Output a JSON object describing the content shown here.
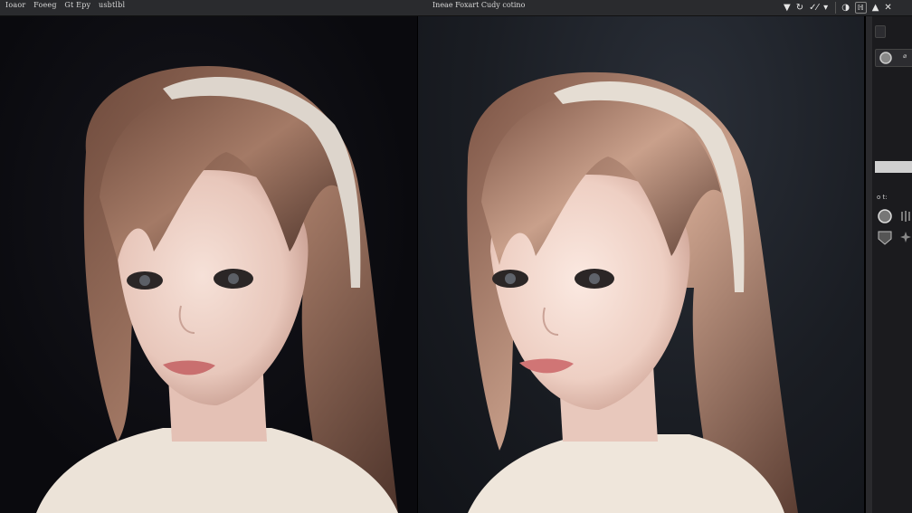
{
  "menu": [
    "Ioaor",
    "Foeeg",
    "Gt Epy",
    "usbtlbl"
  ],
  "window_title": "Ineae Foxart Cudy cotino",
  "toolbar_icons": [
    "filter-icon",
    "rotate-icon",
    "adjust-icon",
    "chevron-down-icon",
    "contrast-icon",
    "histogram-icon",
    "triangle-icon",
    "close-icon"
  ],
  "toolbar_glyphs": [
    "▼",
    "↻",
    "✓⁄",
    "▾",
    "◑",
    "ℍ",
    "▲",
    "✕"
  ],
  "panel": {
    "section_label": "o  t:",
    "side_glyph": "⌀"
  },
  "colors": {
    "topbar": "#2a2b2e",
    "panel": "#1b1b1e",
    "left_canvas": "#0a0a0e",
    "right_canvas": "#1a1d23"
  }
}
